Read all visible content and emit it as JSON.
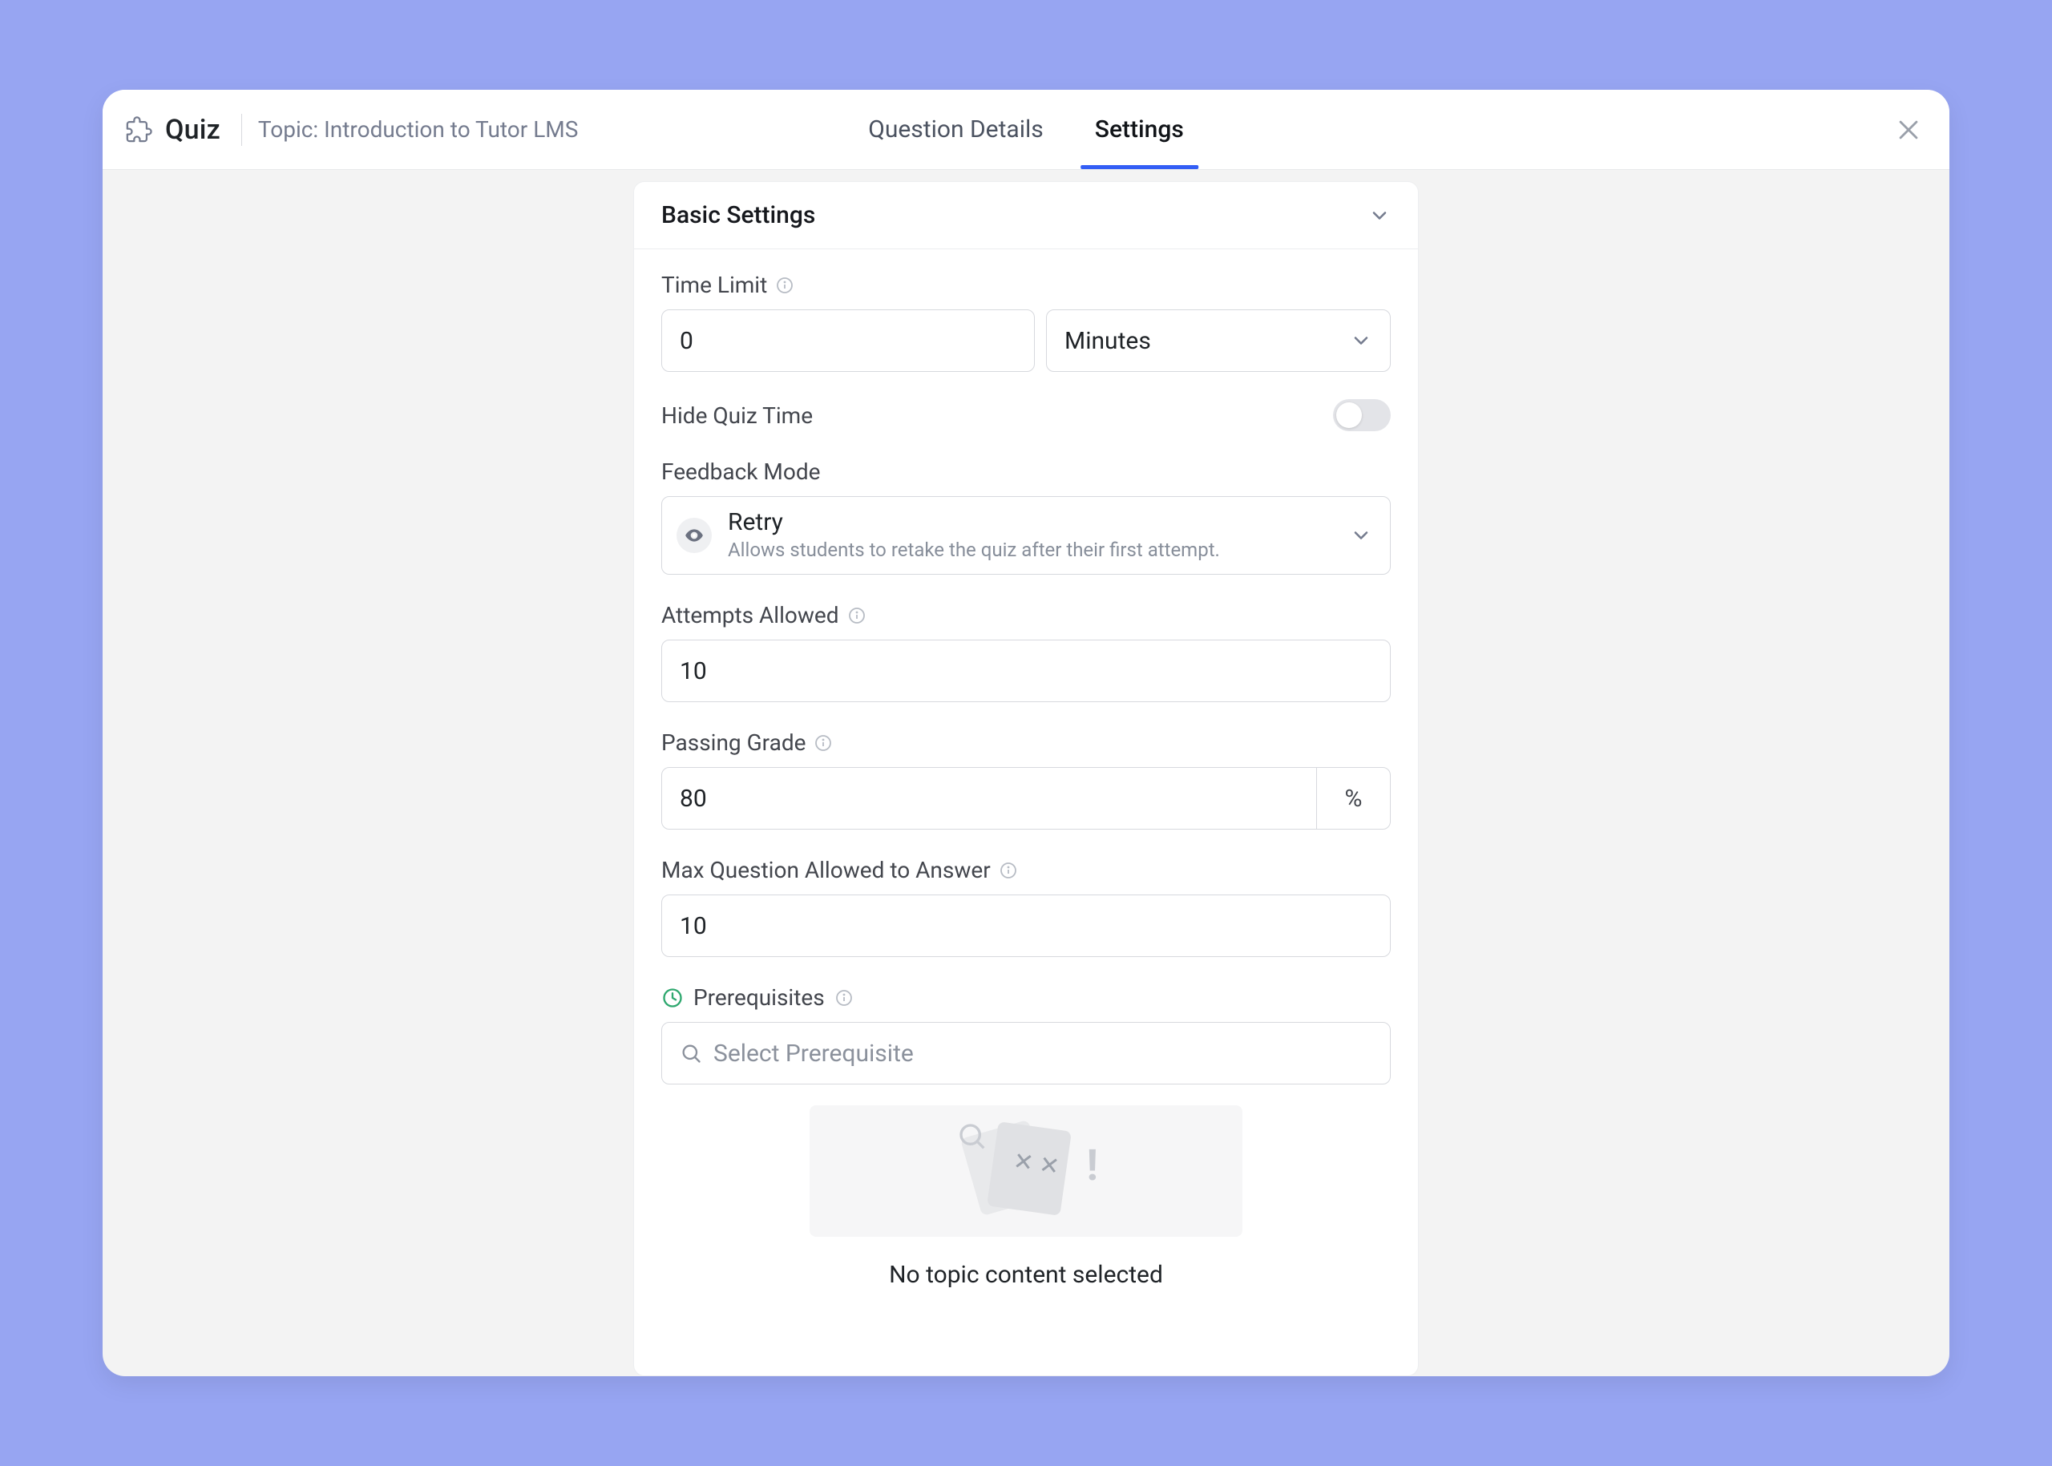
{
  "header": {
    "quiz_label": "Quiz",
    "topic_prefix": "Topic: ",
    "topic_name": "Introduction to Tutor LMS",
    "tab_question_details": "Question Details",
    "tab_settings": "Settings"
  },
  "section": {
    "title": "Basic Settings"
  },
  "time_limit": {
    "label": "Time Limit",
    "value": "0",
    "unit": "Minutes"
  },
  "hide_quiz_time": {
    "label": "Hide Quiz Time",
    "enabled": false
  },
  "feedback": {
    "label": "Feedback Mode",
    "title": "Retry",
    "desc": "Allows students to retake the quiz after their first attempt."
  },
  "attempts": {
    "label": "Attempts Allowed",
    "value": "10"
  },
  "passing_grade": {
    "label": "Passing Grade",
    "value": "80",
    "unit": "%"
  },
  "max_questions": {
    "label": "Max Question Allowed to Answer",
    "value": "10"
  },
  "prerequisites": {
    "label": "Prerequisites",
    "placeholder": "Select Prerequisite",
    "empty_message": "No topic content selected"
  }
}
